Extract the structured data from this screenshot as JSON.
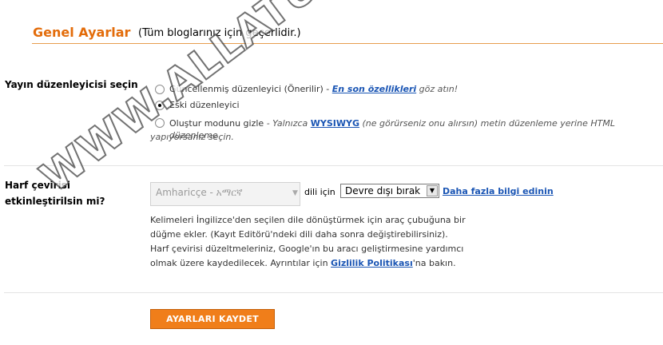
{
  "header": {
    "title": "Genel Ayarlar",
    "subtitle": "(Tüm bloglarınız için geçerlidir.)"
  },
  "editor": {
    "label": "Yayın düzenleyicisi seçin",
    "options": [
      {
        "pre": "Güncellenmiş düzenleyici (Önerilir) - ",
        "link": "En son özellikleri",
        "post": " göz atın!",
        "checked": false
      },
      {
        "pre": "Eski düzenleyici",
        "checked": true
      },
      {
        "pre": "Oluştur modunu gizle",
        "note_a": " - Yalnızca ",
        "link": "WYSIWYG",
        "note_b": " (ne görürseniz onu alırsın) metin düzenleme yerine HTML düzenleme",
        "note_c": "yapıyorsanız seçin.",
        "checked": false
      }
    ]
  },
  "transliteration": {
    "label_line1": "Harf çevirisi",
    "label_line2": "etkinleştirilsin mi?",
    "language_value": "Amharicçe - አማርኛ",
    "language_suffix": "dili için",
    "select_value": "Devre dışı bırak",
    "more_info_link": "Daha fazla bilgi edinin",
    "desc_line1": "Kelimeleri İngilizce'den seçilen dile dönüştürmek için araç çubuğuna bir",
    "desc_line2": "düğme ekler. (Kayıt Editörü'ndeki dili daha sonra değiştirebilirsiniz).",
    "desc_line3": "Harf çevirisi düzeltmeleriniz, Google'ın bu aracı geliştirmesine yardımcı",
    "desc_line4_pre": "olmak üzere kaydedilecek. Ayrıntılar için ",
    "privacy_link": "Gizlilik Politikası",
    "desc_line4_post": "'na bakın."
  },
  "actions": {
    "save_label": "AYARLARI KAYDET"
  },
  "watermark": {
    "text": "WWW.ALLATURKAA.DE"
  },
  "colors": {
    "accent": "#e36c0a",
    "link": "#1a55b4",
    "button": "#f07e1a"
  }
}
